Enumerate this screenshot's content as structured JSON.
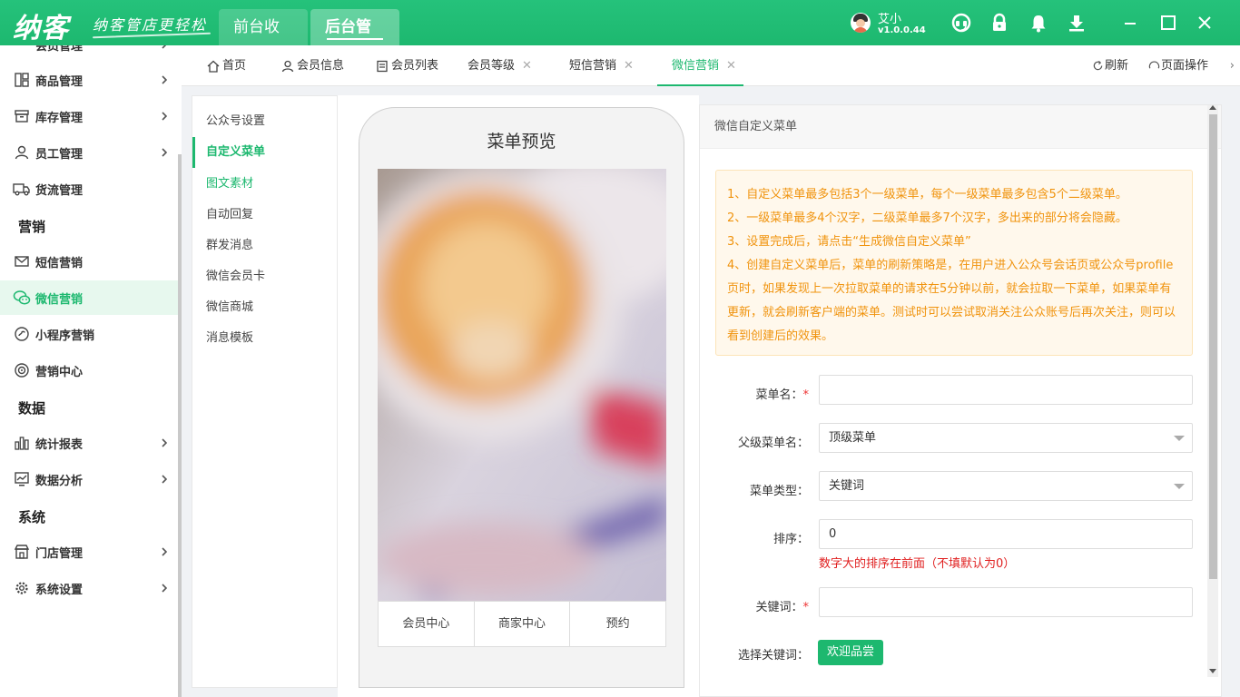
{
  "header": {
    "logo": "纳客",
    "slogan": "纳客管店更轻松",
    "tabs": [
      {
        "label": "前台收银",
        "active": false
      },
      {
        "label": "后台管理",
        "active": true
      }
    ],
    "user": {
      "name": "艾小",
      "version": "v1.0.0.44"
    },
    "icons": [
      "headset-icon",
      "lock-icon",
      "bell-icon",
      "download-icon"
    ],
    "window_controls": [
      "minimize-icon",
      "maximize-icon",
      "close-icon"
    ]
  },
  "sidebar": {
    "partial_top": "会员管理",
    "items": [
      {
        "label": "商品管理",
        "icon": "goods-icon",
        "arrow": true
      },
      {
        "label": "库存管理",
        "icon": "stock-icon",
        "arrow": true
      },
      {
        "label": "员工管理",
        "icon": "staff-icon",
        "arrow": true
      },
      {
        "label": "货流管理",
        "icon": "truck-icon",
        "arrow": false
      }
    ],
    "group_marketing": "营销",
    "marketing_items": [
      {
        "label": "短信营销",
        "icon": "mail-icon",
        "active": false
      },
      {
        "label": "微信营销",
        "icon": "wechat-icon",
        "active": true
      },
      {
        "label": "小程序营销",
        "icon": "miniprogram-icon",
        "active": false
      },
      {
        "label": "营销中心",
        "icon": "target-icon",
        "active": false
      }
    ],
    "group_data": "数据",
    "data_items": [
      {
        "label": "统计报表",
        "icon": "bar-chart-icon",
        "arrow": true
      },
      {
        "label": "数据分析",
        "icon": "analysis-icon",
        "arrow": true
      }
    ],
    "group_system": "系统",
    "system_items": [
      {
        "label": "门店管理",
        "icon": "store-icon",
        "arrow": true
      },
      {
        "label": "系统设置",
        "icon": "gear-icon",
        "arrow": true
      }
    ]
  },
  "tabbar": {
    "tabs": [
      {
        "label": "首页",
        "closable": false,
        "active": false
      },
      {
        "label": "会员信息",
        "closable": false,
        "active": false
      },
      {
        "label": "会员列表",
        "closable": false,
        "active": false
      },
      {
        "label": "会员等级",
        "closable": true,
        "active": false
      },
      {
        "label": "短信营销",
        "closable": true,
        "active": false
      },
      {
        "label": "微信营销",
        "closable": true,
        "active": true
      }
    ],
    "close_glyph": "✕",
    "refresh": "刷新",
    "page_ops": "页面操作",
    "next_glyph": "›"
  },
  "submenu": {
    "items": [
      {
        "label": "公众号设置",
        "state": "normal"
      },
      {
        "label": "自定义菜单",
        "state": "active"
      },
      {
        "label": "图文素材",
        "state": "green"
      },
      {
        "label": "自动回复",
        "state": "normal"
      },
      {
        "label": "群发消息",
        "state": "normal"
      },
      {
        "label": "微信会员卡",
        "state": "normal"
      },
      {
        "label": "微信商城",
        "state": "normal"
      },
      {
        "label": "消息模板",
        "state": "normal"
      }
    ]
  },
  "preview": {
    "title": "菜单预览",
    "menu": [
      "会员中心",
      "商家中心",
      "预约"
    ]
  },
  "form": {
    "header": "微信自定义菜单",
    "notice": [
      "1、自定义菜单最多包括3个一级菜单，每个一级菜单最多包含5个二级菜单。",
      "2、一级菜单最多4个汉字，二级菜单最多7个汉字，多出来的部分将会隐藏。",
      "3、设置完成后，请点击“生成微信自定义菜单”",
      "4、创建自定义菜单后，菜单的刷新策略是，在用户进入公众号会话页或公众号profile页时，如果发现上一次拉取菜单的请求在5分钟以前，就会拉取一下菜单，如果菜单有更新，就会刷新客户端的菜单。测试时可以尝试取消关注公众账号后再次关注，则可以看到创建后的效果。"
    ],
    "fields": {
      "menu_name": {
        "label": "菜单名：",
        "required": true,
        "value": ""
      },
      "parent": {
        "label": "父级菜单名：",
        "value": "顶级菜单"
      },
      "type": {
        "label": "菜单类型：",
        "value": "关键词"
      },
      "order": {
        "label": "排序：",
        "value": "0",
        "hint": "数字大的排序在前面（不填默认为0）"
      },
      "keyword": {
        "label": "关键词：",
        "required": true,
        "value": ""
      },
      "choose_keyword": {
        "label": "选择关键词：",
        "button": "欢迎品尝"
      }
    },
    "required_mark": "*"
  },
  "colors": {
    "brand": "#1db86f",
    "notice_text": "#f0930d",
    "notice_bg": "#fff8ec",
    "hint": "#e02020"
  }
}
